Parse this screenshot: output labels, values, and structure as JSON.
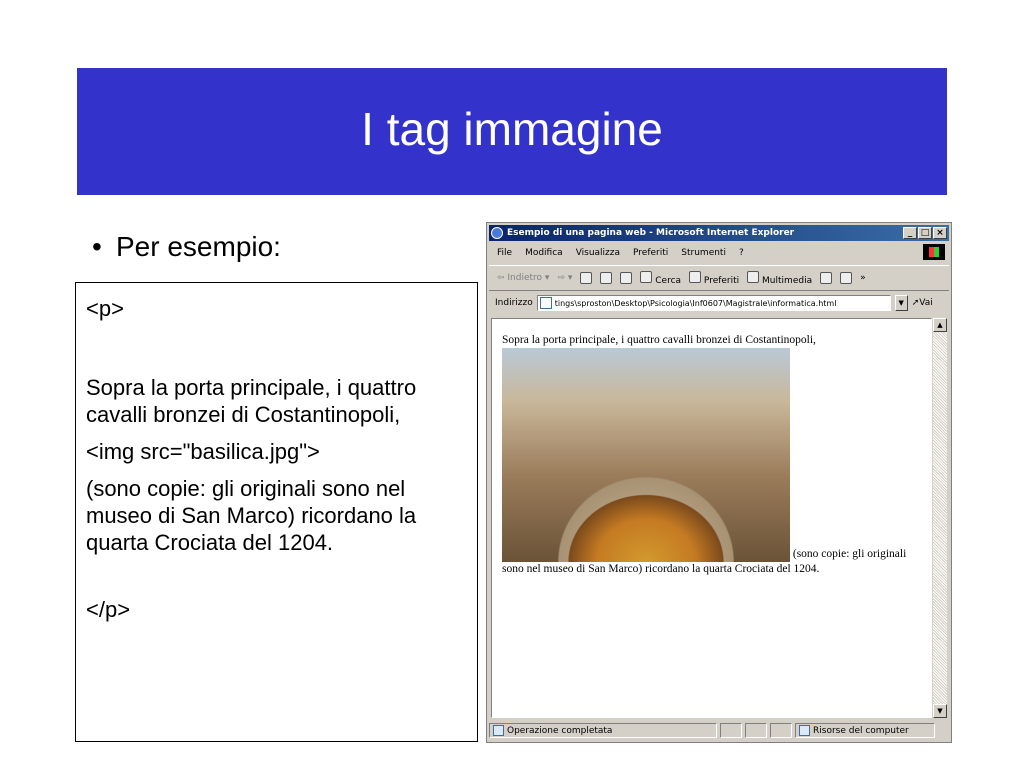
{
  "slide": {
    "title": "I tag immagine",
    "bullet": "Per esempio:",
    "code_lines": {
      "open_p": "<p>",
      "text": "Sopra la porta principale, i quattro cavalli bronzei di Costantinopoli,",
      "img_tag": "<img src=\"basilica.jpg\">",
      "rest": "(sono copie: gli originali sono nel museo di San Marco) ricordano la quarta Crociata del 1204.",
      "close_p": "</p>"
    }
  },
  "browser": {
    "window_title": "Esempio di una pagina web - Microsoft Internet Explorer",
    "window_buttons": [
      "_",
      "□",
      "×"
    ],
    "menu": [
      "File",
      "Modifica",
      "Visualizza",
      "Preferiti",
      "Strumenti",
      "?"
    ],
    "toolbar": {
      "back": "Indietro",
      "search": "Cerca",
      "favorites": "Preferiti",
      "multimedia": "Multimedia",
      "more": "»"
    },
    "address": {
      "label": "Indirizzo",
      "value": "tings\\sproston\\Desktop\\Psicologia\\Inf0607\\Magistrale\\informatica.html",
      "go": "Vai"
    },
    "page": {
      "text_before": "Sopra la porta principale, i quattro cavalli bronzei di Costantinopoli,",
      "text_after": "(sono copie: gli originali sono nel museo di San Marco) ricordano la quarta Crociata del 1204."
    },
    "status": {
      "message": "Operazione completata",
      "zone": "Risorse del computer"
    }
  }
}
